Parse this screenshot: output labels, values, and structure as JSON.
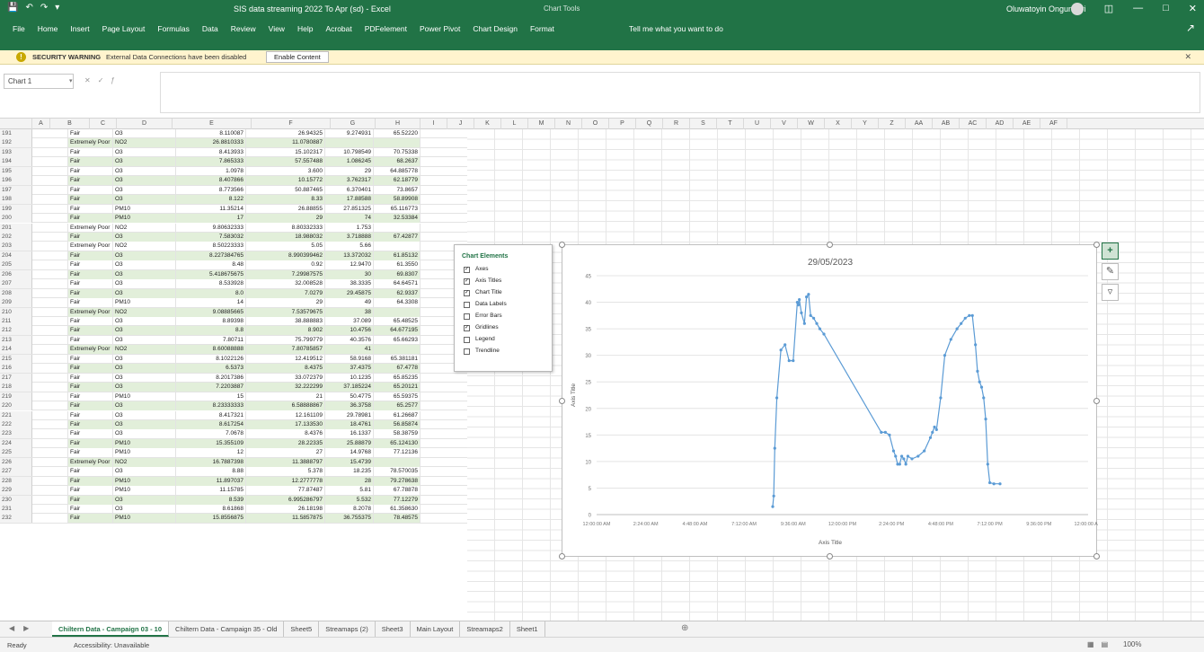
{
  "app": {
    "title": "SIS data streaming 2022 To Apr (sd) - Excel",
    "context_title": "Chart Tools",
    "user": "Oluwatoyin Ongunseri"
  },
  "ribbon": {
    "tabs": [
      "File",
      "Home",
      "Insert",
      "Page Layout",
      "Formulas",
      "Data",
      "Review",
      "View",
      "Help",
      "Acrobat",
      "PDFelement",
      "Power Pivot",
      "Chart Design",
      "Format"
    ],
    "tell_me": "Tell me what you want to do"
  },
  "security_bar": {
    "title": "SECURITY WARNING",
    "message": "External Data Connections have been disabled",
    "button": "Enable Content"
  },
  "formula_bar": {
    "name_box": "Chart 1"
  },
  "grid": {
    "columns": [
      "A",
      "B",
      "C",
      "D",
      "E",
      "F",
      "G",
      "H",
      "I",
      "J",
      "K",
      "L",
      "M",
      "N",
      "O",
      "P",
      "Q",
      "R",
      "S",
      "T",
      "U",
      "V",
      "W",
      "X",
      "Y",
      "Z",
      "AA",
      "AB",
      "AC",
      "AD",
      "AE",
      "AF"
    ],
    "rows": [
      [
        "191",
        "Fair",
        "O3",
        "8.110087",
        "26.94325",
        "9.274931",
        "65.52220"
      ],
      [
        "192",
        "Extremely Poor",
        "NO2",
        "26.8810333",
        "11.0780887",
        "",
        ""
      ],
      [
        "193",
        "Fair",
        "O3",
        "8.413933",
        "15.102317",
        "10.798549",
        "70.75338"
      ],
      [
        "194",
        "Fair",
        "O3",
        "7.865333",
        "57.557488",
        "1.086245",
        "68.2637"
      ],
      [
        "195",
        "Fair",
        "O3",
        "1.0978",
        "3.600",
        "29",
        "64.885778"
      ],
      [
        "196",
        "Fair",
        "O3",
        "8.407866",
        "10.15772",
        "3.762317",
        "62.18779"
      ],
      [
        "197",
        "Fair",
        "O3",
        "8.773566",
        "50.887465",
        "6.370401",
        "73.8657"
      ],
      [
        "198",
        "Fair",
        "O3",
        "8.122",
        "8.33",
        "17.88588",
        "58.89908"
      ],
      [
        "199",
        "Fair",
        "PM10",
        "11.35214",
        "26.88855",
        "27.851325",
        "65.116773"
      ],
      [
        "200",
        "Fair",
        "PM10",
        "17",
        "29",
        "74",
        "32.53384"
      ],
      [
        "201",
        "Extremely Poor",
        "NO2",
        "9.80632333",
        "8.80332333",
        "1.753",
        ""
      ],
      [
        "202",
        "Fair",
        "O3",
        "7.583032",
        "18.988032",
        "3.718888",
        "67.42877"
      ],
      [
        "203",
        "Extremely Poor",
        "NO2",
        "8.50223333",
        "5.05",
        "5.66",
        ""
      ],
      [
        "204",
        "Fair",
        "O3",
        "8.227384765",
        "8.990399462",
        "13.372032",
        "61.85132"
      ],
      [
        "205",
        "Fair",
        "O3",
        "8.48",
        "0.92",
        "12.9470",
        "61.3550"
      ],
      [
        "206",
        "Fair",
        "O3",
        "5.418675675",
        "7.29987575",
        "30",
        "69.8307"
      ],
      [
        "207",
        "Fair",
        "O3",
        "8.533928",
        "32.008528",
        "38.3335",
        "64.64571"
      ],
      [
        "208",
        "Fair",
        "O3",
        "8.0",
        "7.0279",
        "29.45875",
        "62.9337"
      ],
      [
        "209",
        "Fair",
        "PM10",
        "14",
        "29",
        "49",
        "64.3308"
      ],
      [
        "210",
        "Extremely Poor",
        "NO2",
        "9.08885665",
        "7.53579675",
        "38",
        ""
      ],
      [
        "211",
        "Fair",
        "O3",
        "8.89398",
        "38.888883",
        "37.089",
        "65.48525"
      ],
      [
        "212",
        "Fair",
        "O3",
        "8.8",
        "8.902",
        "10.4756",
        "64.677195"
      ],
      [
        "213",
        "Fair",
        "O3",
        "7.80711",
        "75.799779",
        "40.3576",
        "65.66293"
      ],
      [
        "214",
        "Extremely Poor",
        "NO2",
        "8.60088888",
        "7.80785857",
        "41",
        ""
      ],
      [
        "215",
        "Fair",
        "O3",
        "8.1022126",
        "12.419512",
        "58.9168",
        "65.381181"
      ],
      [
        "216",
        "Fair",
        "O3",
        "6.5373",
        "8.4375",
        "37.4375",
        "67.4778"
      ],
      [
        "217",
        "Fair",
        "O3",
        "8.2017386",
        "33.072379",
        "10.1235",
        "65.85235"
      ],
      [
        "218",
        "Fair",
        "O3",
        "7.2203887",
        "32.222299",
        "37.185224",
        "65.20121"
      ],
      [
        "219",
        "Fair",
        "PM10",
        "15",
        "21",
        "50.4775",
        "65.59375"
      ],
      [
        "220",
        "Fair",
        "O3",
        "8.23333333",
        "6.58888867",
        "36.3758",
        "65.2577"
      ],
      [
        "221",
        "Fair",
        "O3",
        "8.417321",
        "12.161109",
        "29.78981",
        "61.26687"
      ],
      [
        "222",
        "Fair",
        "O3",
        "8.617254",
        "17.133530",
        "18.4761",
        "56.85874"
      ],
      [
        "223",
        "Fair",
        "O3",
        "7.0678",
        "8.4376",
        "16.1337",
        "58.38759"
      ],
      [
        "224",
        "Fair",
        "PM10",
        "15.355109",
        "28.22335",
        "25.88879",
        "65.124130"
      ],
      [
        "225",
        "Fair",
        "PM10",
        "12",
        "27",
        "14.9768",
        "77.12136"
      ],
      [
        "226",
        "Extremely Poor",
        "NO2",
        "16.7887398",
        "11.3888797",
        "15.4739",
        ""
      ],
      [
        "227",
        "Fair",
        "O3",
        "8.88",
        "5.378",
        "18.235",
        "78.570035"
      ],
      [
        "228",
        "Fair",
        "PM10",
        "11.897037",
        "12.2777778",
        "28",
        "79.278638"
      ],
      [
        "229",
        "Fair",
        "PM10",
        "11.15785",
        "77.87487",
        "5.81",
        "67.78878"
      ],
      [
        "230",
        "Fair",
        "O3",
        "8.539",
        "6.995286797",
        "5.532",
        "77.12279"
      ],
      [
        "231",
        "Fair",
        "O3",
        "8.61868",
        "26.18198",
        "8.2078",
        "61.358630"
      ],
      [
        "232",
        "Fair",
        "PM10",
        "15.8556875",
        "11.5857875",
        "36.755375",
        "78.48575"
      ]
    ]
  },
  "chart_panel": {
    "title": "Chart Elements",
    "options": [
      {
        "label": "Axes",
        "checked": true
      },
      {
        "label": "Axis Titles",
        "checked": true
      },
      {
        "label": "Chart Title",
        "checked": true
      },
      {
        "label": "Data Labels",
        "checked": false
      },
      {
        "label": "Error Bars",
        "checked": false
      },
      {
        "label": "Gridlines",
        "checked": true
      },
      {
        "label": "Legend",
        "checked": false
      },
      {
        "label": "Trendline",
        "checked": false
      }
    ]
  },
  "side_buttons": {
    "elements_icon": "plus-icon",
    "styles_icon": "brush-icon",
    "filters_icon": "funnel-icon"
  },
  "chart_data": {
    "type": "line",
    "title": "29/05/2023",
    "xlabel": "Axis Title",
    "ylabel": "Axis Title",
    "x_ticks": [
      "12:00:00 AM",
      "2:24:00 AM",
      "4:48:00 AM",
      "7:12:00 AM",
      "9:36:00 AM",
      "12:00:00 PM",
      "2:24:00 PM",
      "4:48:00 PM",
      "7:12:00 PM",
      "9:36:00 PM",
      "12:00:00 AM"
    ],
    "y_ticks": [
      "0",
      "5",
      "10",
      "15",
      "20",
      "25",
      "30",
      "35",
      "40",
      "45"
    ],
    "xlim": [
      0,
      24
    ],
    "ylim": [
      0,
      45
    ],
    "grid": true,
    "color": "#5b9bd5",
    "x": [
      8.6,
      8.65,
      8.7,
      8.8,
      9.0,
      9.2,
      9.4,
      9.6,
      9.8,
      9.85,
      9.9,
      10.0,
      10.15,
      10.25,
      10.35,
      10.45,
      10.6,
      10.75,
      10.9,
      11.1,
      13.9,
      14.1,
      14.3,
      14.5,
      14.6,
      14.7,
      14.8,
      14.9,
      15.0,
      15.1,
      15.2,
      15.4,
      15.7,
      16.0,
      16.3,
      16.4,
      16.5,
      16.6,
      16.8,
      17.0,
      17.3,
      17.6,
      17.8,
      18.0,
      18.2,
      18.35,
      18.5,
      18.6,
      18.7,
      18.8,
      18.9,
      19.0,
      19.1,
      19.2,
      19.4,
      19.7
    ],
    "y": [
      1.5,
      3.5,
      12.5,
      22,
      31,
      32,
      29,
      29,
      40,
      39.5,
      40.5,
      38,
      36,
      41,
      41.5,
      37.5,
      37,
      36,
      35,
      34,
      15.5,
      15.5,
      15,
      12,
      11,
      9.5,
      9.5,
      11,
      10.5,
      9.5,
      11,
      10.5,
      11,
      12,
      14.5,
      15.5,
      16.5,
      16,
      22,
      30,
      33,
      35,
      36,
      37,
      37.5,
      37.5,
      32,
      27,
      25,
      24,
      22,
      18,
      9.5,
      6,
      5.8,
      5.8
    ]
  },
  "sheets": {
    "tabs": [
      "Chiltern Data - Campaign 03 - 10",
      "Chiltern Data - Campaign 35 - Old",
      "Sheet5",
      "Streamaps (2)",
      "Sheet3",
      "Main Layout",
      "Streamaps2",
      "Sheet1"
    ],
    "active": 0
  },
  "status": {
    "ready": "Ready",
    "accessibility": "Accessibility: Unavailable",
    "zoom": "100%"
  }
}
